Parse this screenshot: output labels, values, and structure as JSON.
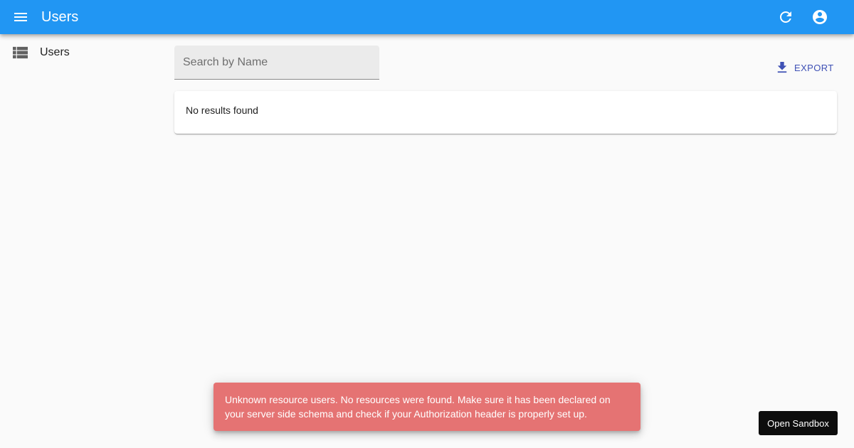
{
  "appbar": {
    "title": "Users",
    "menu_icon": "menu-icon",
    "refresh_icon": "refresh-icon",
    "account_icon": "account-circle-icon",
    "background": "#2196f3"
  },
  "sidebar": {
    "items": [
      {
        "label": "Users",
        "icon": "list-icon"
      }
    ]
  },
  "search": {
    "placeholder": "Search by Name",
    "value": ""
  },
  "toolbar": {
    "export_label": "EXPORT",
    "export_icon": "download-icon",
    "export_color": "#3f51b5"
  },
  "results": {
    "empty_message": "No results found"
  },
  "notification": {
    "message": "Unknown resource users. No resources were found. Make sure it has been declared on your server side schema and check if your Authorization header is properly set up.",
    "background": "#e57373"
  },
  "sandbox": {
    "label": "Open Sandbox"
  }
}
